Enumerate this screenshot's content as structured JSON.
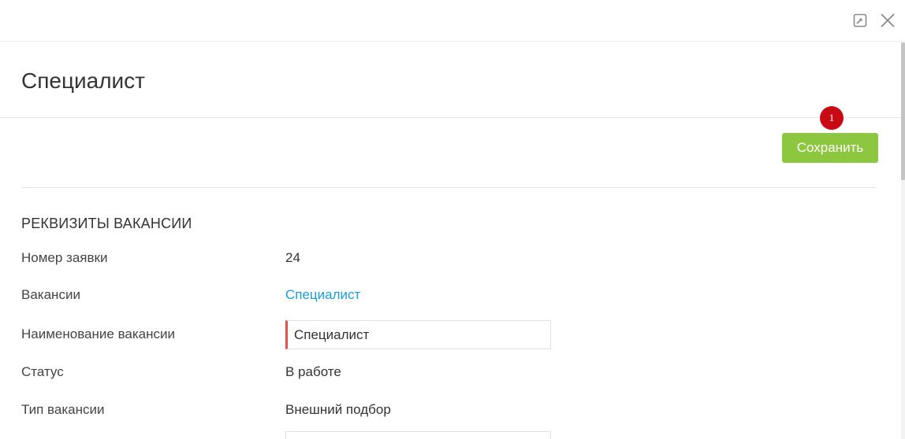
{
  "window": {
    "expand_icon": "expand-icon",
    "close_icon": "close-icon"
  },
  "header": {
    "title": "Специалист"
  },
  "toolbar": {
    "badge_count": "1",
    "save_label": "Сохранить",
    "save_color": "#8dc63f",
    "badge_color": "#c90a14"
  },
  "section": {
    "heading": "РЕКВИЗИТЫ ВАКАНСИИ",
    "fields": [
      {
        "label": "Номер заявки",
        "value": "24"
      },
      {
        "label": "Вакансии",
        "value": "Специалист"
      },
      {
        "label": "Наименование вакансии",
        "value": "Специалист"
      },
      {
        "label": "Статус",
        "value": "В работе"
      },
      {
        "label": "Тип вакансии",
        "value": "Внешний подбор"
      }
    ]
  },
  "colors": {
    "link": "#1e9bd7",
    "required_marker": "#e0534a"
  }
}
